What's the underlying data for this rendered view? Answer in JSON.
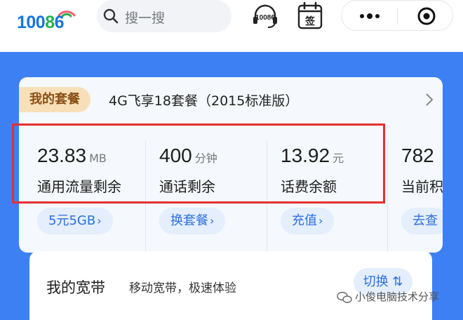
{
  "header": {
    "logo_text_part1": "100",
    "logo_text_part2": "8",
    "logo_text_part3": "6",
    "search_placeholder": "搜一搜",
    "service_icon_label": "10086",
    "signin_icon_label": "签"
  },
  "package": {
    "badge": "我的套餐",
    "name": "4G飞享18套餐（2015标准版）",
    "stats": [
      {
        "value": "23.83",
        "unit": "MB",
        "label": "通用流量剩余",
        "button": "5元5GB"
      },
      {
        "value": "400",
        "unit": "分钟",
        "label": "通话剩余",
        "button": "换套餐"
      },
      {
        "value": "13.92",
        "unit": "元",
        "label": "话费余额",
        "button": "充值"
      },
      {
        "value": "782",
        "unit": "",
        "label": "当前积",
        "button": "去查"
      }
    ]
  },
  "broadband": {
    "title": "我的宽带",
    "subtitle": "移动宽带，极速体验",
    "button": "切换"
  },
  "watermark": "小俊电脑技术分享",
  "colors": {
    "brand_blue": "#1576dd",
    "band_blue": "#3c80f4",
    "accent_link": "#2c6fe0",
    "highlight_red": "#e53030",
    "badge_bg": "#f7dfb9"
  }
}
